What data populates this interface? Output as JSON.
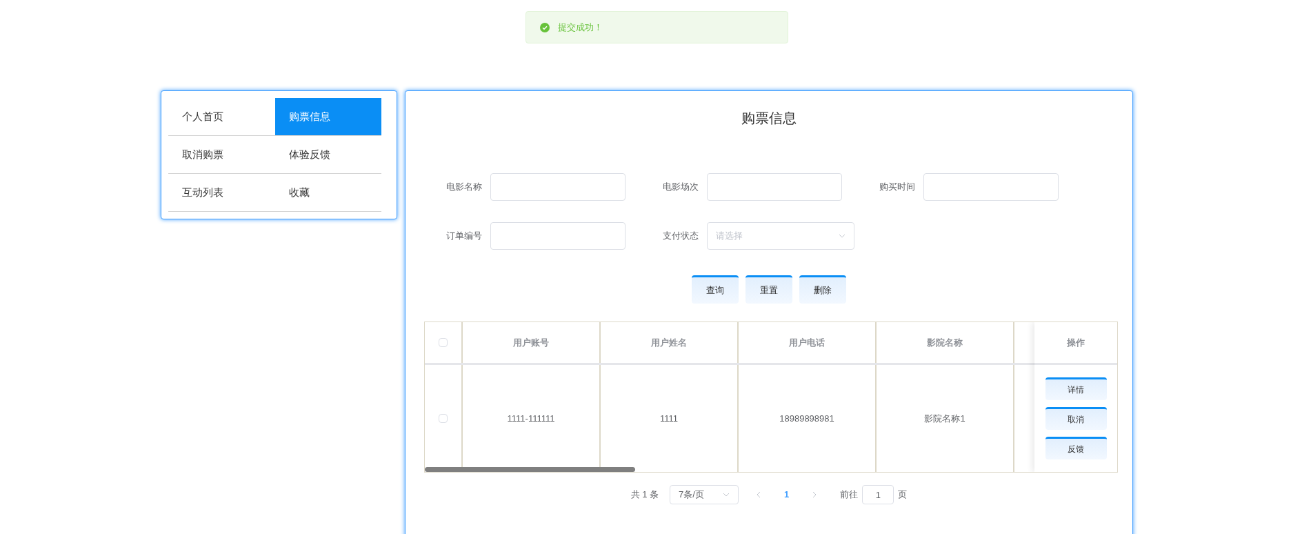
{
  "toast": {
    "kind": "success",
    "message": "提交成功！"
  },
  "menu": [
    {
      "label": "个人首页",
      "selected": false
    },
    {
      "label": "购票信息",
      "selected": true
    },
    {
      "label": "取消购票",
      "selected": false
    },
    {
      "label": "体验反馈",
      "selected": false
    },
    {
      "label": "互动列表",
      "selected": false
    },
    {
      "label": "收藏",
      "selected": false
    }
  ],
  "panel": {
    "title": "购票信息"
  },
  "filters": [
    {
      "kind": "text",
      "label": "电影名称"
    },
    {
      "kind": "text",
      "label": "电影场次"
    },
    {
      "kind": "text",
      "label": "购买时间"
    },
    {
      "kind": "text",
      "label": "订单编号"
    },
    {
      "kind": "select",
      "label": "支付状态",
      "placeholder": "请选择"
    }
  ],
  "buttons": [
    "查询",
    "重置",
    "删除"
  ],
  "table": {
    "all_checked": false,
    "columns": [
      "用户账号",
      "用户姓名",
      "用户电话",
      "影院名称"
    ],
    "action_column": "操作",
    "rows": [
      {
        "checked": false,
        "cells": [
          "1111-111111",
          "1111",
          "18989898981",
          "影院名称1"
        ],
        "actions": [
          "详情",
          "取消",
          "反馈"
        ]
      }
    ]
  },
  "pagination": {
    "total": "共 1 条",
    "page_size": "7条/页",
    "pages": [
      {
        "label": "1",
        "selected": true
      }
    ],
    "goto_label": "前往",
    "goto_value": "1",
    "goto_suffix": "页"
  }
}
